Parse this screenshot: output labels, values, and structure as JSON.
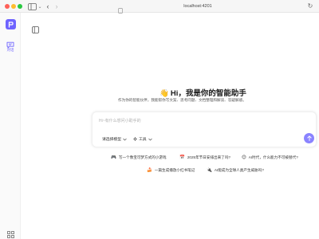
{
  "browser": {
    "url": "localhost:4201",
    "colors": {
      "close": "#fe5f57",
      "minimize": "#febc2e",
      "zoom": "#28c840"
    }
  },
  "sidebar": {
    "brand_color": "#6e63ff",
    "items": [
      {
        "label": "对话",
        "icon": "chat-bubble-icon",
        "active": true
      }
    ],
    "bottom_icon": "grid-icon"
  },
  "hero": {
    "emoji": "👋",
    "title": "Hi，我是你的智能助手",
    "subtitle": "作为你的智能伙伴，我能帮你写文案、思考问题、文档整理和解读、答疑解惑。"
  },
  "composer": {
    "placeholder": "Hi~有什么想问小助手的",
    "model_label": "请选择模型",
    "tools_label": "工具",
    "send_color": "#8a83ff"
  },
  "suggestions": [
    {
      "icon": "🎮",
      "text": "写一个像宝可梦方式的小游戏"
    },
    {
      "icon": "📅",
      "text": "2025年节日安排出来了吗?"
    },
    {
      "icon": "😊",
      "text": "AI时代，什么能力不可被替代?"
    },
    {
      "icon": "🍰",
      "text": "一篇生成播放小红书笔记"
    },
    {
      "icon": "🔌",
      "text": "AI能成为全球人类产生威胁吗?"
    }
  ]
}
